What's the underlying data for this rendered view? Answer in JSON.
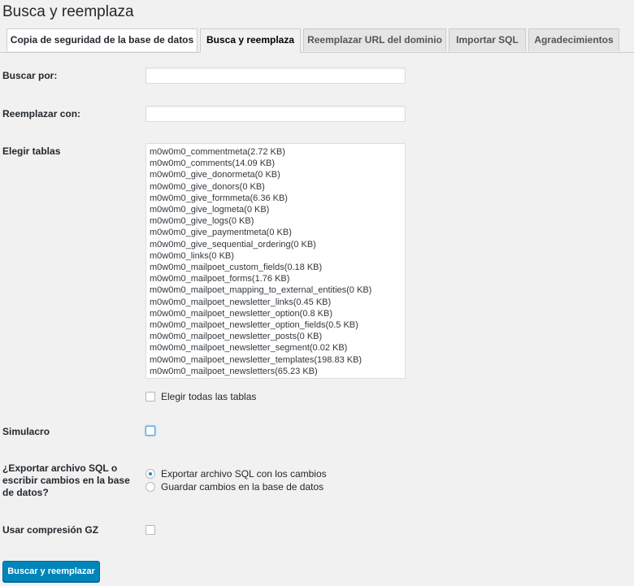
{
  "page": {
    "title": "Busca y reemplaza"
  },
  "tabs": [
    {
      "label": "Copia de seguridad de la base de datos"
    },
    {
      "label": "Busca y reemplaza"
    },
    {
      "label": "Reemplazar URL del dominio"
    },
    {
      "label": "Importar SQL"
    },
    {
      "label": "Agradecimientos"
    }
  ],
  "form": {
    "search_label": "Buscar por:",
    "search_value": "",
    "replace_label": "Reemplazar con:",
    "replace_value": "",
    "tables_label": "Elegir tablas",
    "tables": [
      "m0w0m0_commentmeta(2.72 KB)",
      "m0w0m0_comments(14.09 KB)",
      "m0w0m0_give_donormeta(0 KB)",
      "m0w0m0_give_donors(0 KB)",
      "m0w0m0_give_formmeta(6.36 KB)",
      "m0w0m0_give_logmeta(0 KB)",
      "m0w0m0_give_logs(0 KB)",
      "m0w0m0_give_paymentmeta(0 KB)",
      "m0w0m0_give_sequential_ordering(0 KB)",
      "m0w0m0_links(0 KB)",
      "m0w0m0_mailpoet_custom_fields(0.18 KB)",
      "m0w0m0_mailpoet_forms(1.76 KB)",
      "m0w0m0_mailpoet_mapping_to_external_entities(0 KB)",
      "m0w0m0_mailpoet_newsletter_links(0.45 KB)",
      "m0w0m0_mailpoet_newsletter_option(0.8 KB)",
      "m0w0m0_mailpoet_newsletter_option_fields(0.5 KB)",
      "m0w0m0_mailpoet_newsletter_posts(0 KB)",
      "m0w0m0_mailpoet_newsletter_segment(0.02 KB)",
      "m0w0m0_mailpoet_newsletter_templates(198.83 KB)",
      "m0w0m0_mailpoet_newsletters(65.23 KB)"
    ],
    "select_all_label": "Elegir todas las tablas",
    "dry_run_label": "Simulacro",
    "export_label_line1": "¿Exportar archivo SQL o",
    "export_label_line2": "escribir cambios en la base",
    "export_label_line3": "de datos?",
    "export_option_sql": "Exportar archivo SQL con los cambios",
    "export_option_db": "Guardar cambios en la base de datos",
    "gz_label": "Usar compresión GZ",
    "submit_label": "Buscar y reemplazar"
  },
  "colors": {
    "primary_button": "#0085ba",
    "background": "#f1f1f1",
    "focus_blue": "#5b9dd9"
  }
}
